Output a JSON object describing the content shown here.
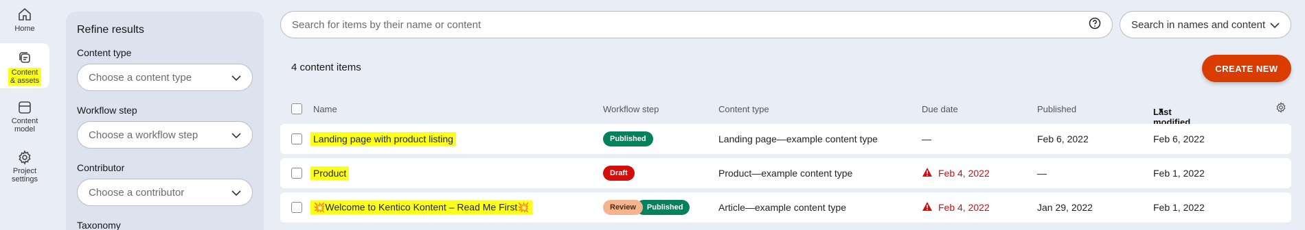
{
  "nav": {
    "home": "Home",
    "content_assets": "Content\n& assets",
    "content_model": "Content\nmodel",
    "project_settings": "Project\nsettings"
  },
  "filters": {
    "title": "Refine results",
    "content_type_label": "Content type",
    "content_type_placeholder": "Choose a content type",
    "workflow_label": "Workflow step",
    "workflow_placeholder": "Choose a workflow step",
    "contributor_label": "Contributor",
    "contributor_placeholder": "Choose a contributor",
    "taxonomy_label": "Taxonomy"
  },
  "search": {
    "placeholder": "Search for items by their name or content",
    "scope": "Search in names and content"
  },
  "list": {
    "count": "4 content items",
    "create_label": "CREATE NEW",
    "columns": {
      "name": "Name",
      "workflow": "Workflow step",
      "content_type": "Content type",
      "due": "Due date",
      "published": "Published",
      "last_modified": "Last modified"
    },
    "rows": [
      {
        "name": "Landing page with product listing",
        "workflow": [
          "Published"
        ],
        "content_type": "Landing page—example content type",
        "due": "—",
        "due_overdue": false,
        "published": "Feb 6, 2022",
        "modified": "Feb 6, 2022"
      },
      {
        "name": "Product",
        "workflow": [
          "Draft"
        ],
        "content_type": "Product—example content type",
        "due": "Feb 4, 2022",
        "due_overdue": true,
        "published": "—",
        "modified": "Feb 1, 2022"
      },
      {
        "name": "💥Welcome to Kentico Kontent – Read Me First💥",
        "workflow": [
          "Review",
          "Published"
        ],
        "content_type": "Article—example content type",
        "due": "Feb 4, 2022",
        "due_overdue": true,
        "published": "Jan 29, 2022",
        "modified": "Feb 1, 2022"
      }
    ]
  },
  "colors": {
    "accent": "#db3c00",
    "published": "#07815a",
    "draft": "#d30c0c",
    "review": "#f6b38e",
    "highlight": "#fbff1a"
  }
}
